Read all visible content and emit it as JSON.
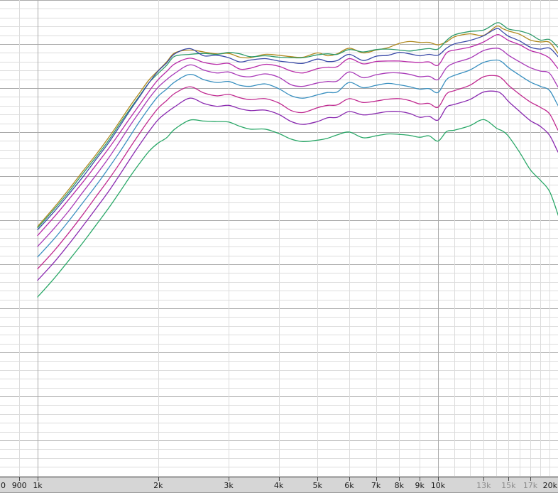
{
  "colors": {
    "background": "#ffffff",
    "grid_minor": "#dcdcdc",
    "grid_major": "#a9a9a9",
    "axis_bar": "#d6d6d6",
    "tick_text": "#1a1a1a",
    "tick_text_faded": "#8c8c8c"
  },
  "chart_data": {
    "type": "line",
    "title": "",
    "xlabel": "",
    "ylabel": "",
    "x_scale": "log",
    "xlim": [
      800,
      21000
    ],
    "ylim": [
      0,
      100
    ],
    "grid": true,
    "legend": "none",
    "x_ticks": [
      {
        "value": 800,
        "label": "0",
        "faded": false
      },
      {
        "value": 900,
        "label": "900",
        "faded": false
      },
      {
        "value": 1000,
        "label": "1k",
        "faded": false
      },
      {
        "value": 2000,
        "label": "2k",
        "faded": false
      },
      {
        "value": 3000,
        "label": "3k",
        "faded": false
      },
      {
        "value": 4000,
        "label": "4k",
        "faded": false
      },
      {
        "value": 5000,
        "label": "5k",
        "faded": false
      },
      {
        "value": 6000,
        "label": "6k",
        "faded": false
      },
      {
        "value": 7000,
        "label": "7k",
        "faded": false
      },
      {
        "value": 8000,
        "label": "8k",
        "faded": false
      },
      {
        "value": 9000,
        "label": "9k",
        "faded": false
      },
      {
        "value": 10000,
        "label": "10k",
        "faded": false
      },
      {
        "value": 13000,
        "label": "13k",
        "faded": true
      },
      {
        "value": 15000,
        "label": "15k",
        "faded": true
      },
      {
        "value": 17000,
        "label": "17k",
        "faded": true
      },
      {
        "value": 20000,
        "label": "20k",
        "faded": false
      }
    ],
    "major_gridlines_x": [
      1000,
      10000
    ],
    "x": [
      1000,
      1100,
      1200,
      1300,
      1400,
      1500,
      1600,
      1700,
      1800,
      1900,
      2000,
      2100,
      2200,
      2400,
      2600,
      2800,
      3000,
      3200,
      3400,
      3700,
      4000,
      4300,
      4600,
      5000,
      5300,
      5600,
      6000,
      6500,
      7000,
      7500,
      8000,
      8500,
      9000,
      9500,
      10000,
      10500,
      11000,
      12000,
      13000,
      14000,
      14500,
      15000,
      16000,
      17000,
      18000,
      19000,
      20000,
      21000
    ],
    "series": [
      {
        "color": "#b08a20",
        "values": [
          52.5,
          56.5,
          60.4,
          64.2,
          67.6,
          71.0,
          74.4,
          77.7,
          80.6,
          83.3,
          85.2,
          87.0,
          88.9,
          89.5,
          89.1,
          88.7,
          88.8,
          88.0,
          87.9,
          88.6,
          88.4,
          88.1,
          88.0,
          88.9,
          88.3,
          88.7,
          89.9,
          88.9,
          89.5,
          90.0,
          90.9,
          91.3,
          91.1,
          91.1,
          90.6,
          91.2,
          92.3,
          92.9,
          92.6,
          94.5,
          94.0,
          93.5,
          92.8,
          91.6,
          91.2,
          91.1,
          88.7,
          87.3
        ]
      },
      {
        "color": "#2e9a6a",
        "values": [
          52.2,
          56.1,
          59.9,
          63.7,
          67.1,
          70.4,
          73.9,
          77.1,
          80.0,
          82.7,
          84.6,
          86.3,
          88.2,
          88.6,
          88.8,
          88.6,
          89.0,
          88.7,
          88.1,
          88.3,
          88.0,
          87.9,
          87.9,
          88.5,
          88.7,
          88.6,
          89.6,
          89.1,
          89.6,
          89.7,
          89.5,
          89.3,
          89.6,
          89.8,
          89.7,
          91.5,
          92.7,
          93.4,
          93.7,
          95.2,
          94.8,
          93.9,
          93.5,
          92.8,
          91.6,
          91.7,
          90.0,
          88.9
        ]
      },
      {
        "color": "#3a4aa8",
        "values": [
          51.8,
          55.6,
          59.4,
          63.0,
          66.6,
          69.9,
          73.4,
          76.8,
          79.8,
          82.7,
          85.1,
          86.8,
          88.7,
          89.8,
          88.3,
          88.4,
          87.9,
          87.0,
          87.4,
          87.7,
          87.2,
          86.9,
          86.7,
          87.6,
          87.1,
          87.3,
          88.6,
          87.3,
          88.2,
          88.4,
          89.0,
          88.7,
          88.3,
          88.6,
          88.4,
          89.9,
          90.8,
          91.5,
          92.5,
          94.0,
          93.3,
          92.4,
          91.4,
          90.1,
          89.7,
          89.9,
          88.0,
          86.4
        ]
      },
      {
        "color": "#b82aa8",
        "values": [
          50.6,
          54.5,
          58.3,
          61.9,
          65.4,
          68.7,
          72.0,
          75.2,
          78.1,
          80.9,
          83.3,
          85.0,
          86.6,
          87.8,
          86.9,
          86.5,
          86.7,
          85.5,
          85.7,
          86.5,
          86.1,
          85.1,
          84.7,
          85.6,
          85.9,
          86.0,
          87.7,
          86.6,
          87.1,
          87.2,
          87.2,
          87.0,
          86.9,
          87.0,
          86.3,
          88.9,
          89.5,
          90.1,
          91.2,
          92.7,
          92.3,
          91.5,
          90.6,
          89.4,
          88.8,
          87.8,
          85.5,
          84.0
        ]
      },
      {
        "color": "#a83ab8",
        "values": [
          48.3,
          52.1,
          55.9,
          59.8,
          63.3,
          66.7,
          70.2,
          73.6,
          76.6,
          79.4,
          81.7,
          83.3,
          84.6,
          86.4,
          85.3,
          84.7,
          84.9,
          84.1,
          83.9,
          84.5,
          83.8,
          82.2,
          81.9,
          82.6,
          82.9,
          83.0,
          84.9,
          83.7,
          84.3,
          84.7,
          84.7,
          84.4,
          83.9,
          84.0,
          83.3,
          85.8,
          86.8,
          87.8,
          89.4,
          89.9,
          89.4,
          88.4,
          87.0,
          85.8,
          85.1,
          84.6,
          81.6,
          79.7
        ]
      },
      {
        "color": "#3a90c0",
        "values": [
          46.1,
          49.9,
          53.8,
          57.6,
          61.1,
          64.6,
          68.0,
          71.4,
          74.6,
          77.4,
          79.8,
          81.3,
          82.8,
          84.4,
          83.3,
          82.7,
          82.9,
          82.1,
          81.9,
          82.4,
          81.4,
          79.9,
          79.4,
          80.1,
          80.6,
          80.7,
          82.7,
          81.6,
          82.1,
          82.5,
          82.2,
          81.8,
          81.3,
          81.4,
          80.6,
          83.3,
          84.2,
          85.3,
          86.9,
          87.4,
          86.9,
          85.8,
          84.2,
          82.8,
          81.9,
          81.0,
          77.7,
          75.8
        ]
      },
      {
        "color": "#c02a90",
        "values": [
          43.6,
          47.4,
          51.3,
          55.1,
          58.8,
          62.2,
          65.6,
          69.0,
          72.1,
          74.9,
          77.3,
          78.9,
          80.4,
          81.8,
          80.5,
          79.9,
          80.2,
          79.5,
          79.1,
          79.3,
          78.4,
          76.8,
          76.4,
          77.4,
          77.9,
          78.0,
          79.3,
          78.5,
          78.8,
          79.2,
          79.3,
          78.9,
          78.2,
          78.3,
          77.5,
          80.3,
          81.0,
          82.1,
          83.9,
          84.1,
          83.4,
          82.1,
          80.2,
          78.6,
          77.5,
          76.1,
          72.5,
          70.2
        ]
      },
      {
        "color": "#8a2ab0",
        "values": [
          41.2,
          45.0,
          48.9,
          52.7,
          56.3,
          59.7,
          63.2,
          66.6,
          69.7,
          72.5,
          74.9,
          76.4,
          77.6,
          79.4,
          78.3,
          77.7,
          77.9,
          77.2,
          76.8,
          76.9,
          76.0,
          74.5,
          73.9,
          74.5,
          75.3,
          75.4,
          76.6,
          75.9,
          76.2,
          76.6,
          76.6,
          76.2,
          75.4,
          75.6,
          74.8,
          77.5,
          78.1,
          79.1,
          80.7,
          80.8,
          80.1,
          78.7,
          76.6,
          74.7,
          73.5,
          71.6,
          67.9,
          65.2
        ]
      },
      {
        "color": "#2aa868",
        "values": [
          37.7,
          41.6,
          45.5,
          49.2,
          52.8,
          56.2,
          59.6,
          62.9,
          65.8,
          68.3,
          70.0,
          71.1,
          72.9,
          74.8,
          74.6,
          74.5,
          74.4,
          73.5,
          72.9,
          72.9,
          72.0,
          70.8,
          70.3,
          70.6,
          71.0,
          71.7,
          72.3,
          71.1,
          71.5,
          71.9,
          71.8,
          71.6,
          71.2,
          71.5,
          70.4,
          72.4,
          72.7,
          73.6,
          74.9,
          73.1,
          72.5,
          71.4,
          68.0,
          64.4,
          62.2,
          59.8,
          54.6,
          49.0
        ]
      }
    ]
  }
}
